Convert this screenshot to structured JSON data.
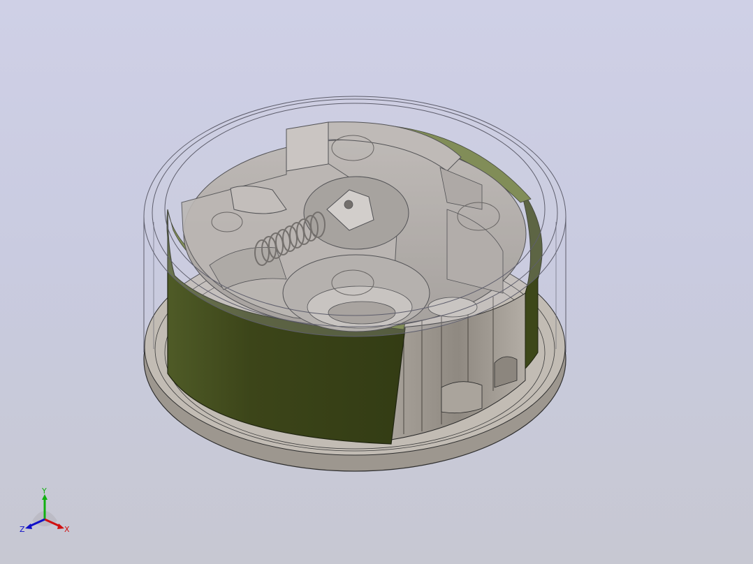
{
  "viewport": {
    "background_top": "#cfd0e6",
    "background_bottom": "#c7c8d2"
  },
  "model": {
    "description_parts": [
      "housing-base",
      "green-brake-lining",
      "transparent-cover",
      "coil-spring",
      "inner-mechanism"
    ],
    "colors": {
      "metal": "#a9a39a",
      "metal_dark": "#7d776f",
      "metal_light": "#cdc8c0",
      "lining": "#4e5a25",
      "lining_dark": "#343d17",
      "lining_edge": "#6f7d34",
      "glass_edge": "#6c6c7a"
    }
  },
  "triad": {
    "x_label": "X",
    "y_label": "Y",
    "z_label": "Z",
    "x_color": "#d01010",
    "y_color": "#10b010",
    "z_color": "#1010c8"
  }
}
